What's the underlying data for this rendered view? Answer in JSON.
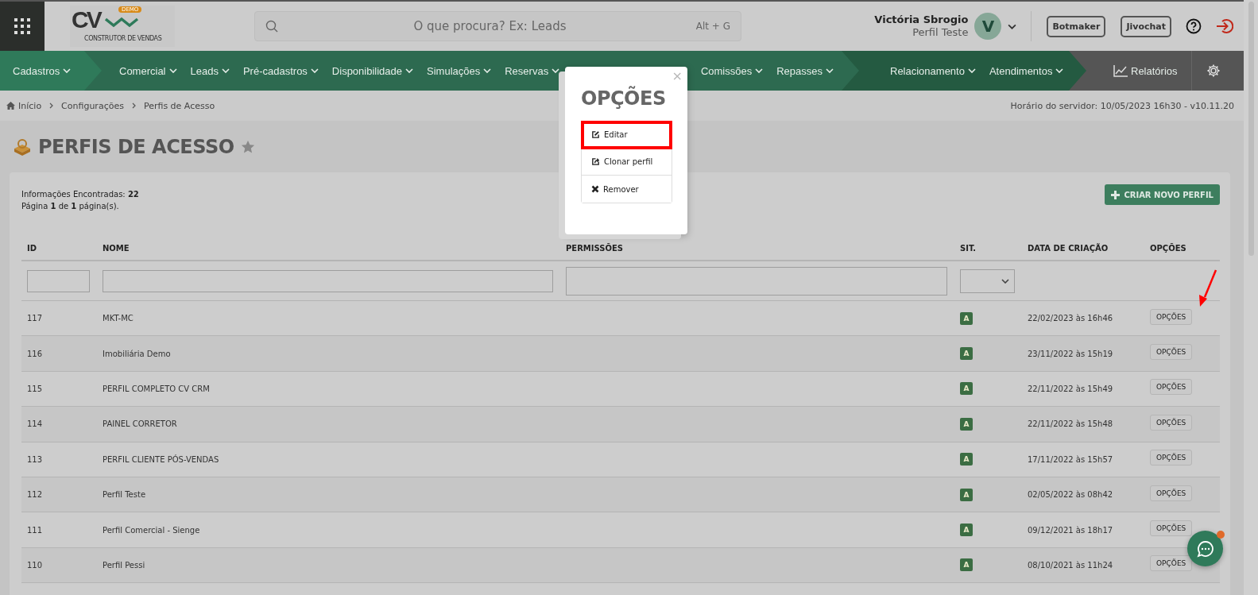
{
  "header": {
    "logo_text": "CV",
    "logo_badge": "DEMO",
    "logo_tagline": "CONSTRUTOR DE VENDAS",
    "search": {
      "placeholder": "O que procura? Ex: Leads",
      "shortcut": "Alt + G"
    },
    "user": {
      "name": "Victória Sbrogio",
      "role": "Perfil Teste",
      "initial": "V"
    },
    "buttons": [
      "Botmaker",
      "Jivochat"
    ]
  },
  "nav": [
    {
      "items": [
        "Cadastros"
      ]
    },
    {
      "items": [
        "Comercial",
        "Leads",
        "Pré-cadastros",
        "Disponibilidade",
        "Simulações",
        "Reservas",
        "Comissões",
        "Repasses"
      ]
    },
    {
      "items": [
        "Relacionamento",
        "Atendimentos"
      ]
    },
    {
      "items": [
        "Relatórios"
      ],
      "kind": "tools"
    }
  ],
  "breadcrumb": [
    "Início",
    "Configurações",
    "Perfis de Acesso"
  ],
  "server_time": "Horário do servidor: 10/05/2023 16h30 - v10.11.20",
  "page_title": "PERFIS DE ACESSO",
  "summary": [
    "Informações Encontradas: **22**",
    "Página **1** de **1** página(s)."
  ],
  "create_button": "CRIAR NOVO PERFIL",
  "table": {
    "columns": [
      {
        "label": "ID",
        "kind": "text"
      },
      {
        "label": "NOME",
        "kind": "text"
      },
      {
        "label": "PERMISSÕES",
        "kind": "textarea"
      },
      {
        "label": "SIT.",
        "kind": "select"
      },
      {
        "label": "DATA DE CRIAÇÃO",
        "kind": "none"
      },
      {
        "label": "OPÇÕES",
        "kind": "none"
      }
    ],
    "rows": [
      {
        "id": "117",
        "name": "MKT-MC",
        "status": "A",
        "created": "22/02/2023 às 16h46",
        "action": "OPÇÕES"
      },
      {
        "id": "116",
        "name": "Imobiliária Demo",
        "status": "A",
        "created": "23/11/2022 às 15h19",
        "action": "OPÇÕES"
      },
      {
        "id": "115",
        "name": "PERFIL COMPLETO CV CRM",
        "status": "A",
        "created": "22/11/2022 às 15h49",
        "action": "OPÇÕES"
      },
      {
        "id": "114",
        "name": "PAINEL CORRETOR",
        "status": "A",
        "created": "22/11/2022 às 15h48",
        "action": "OPÇÕES"
      },
      {
        "id": "113",
        "name": "PERFIL CLIENTE PÓS-VENDAS",
        "status": "A",
        "created": "17/11/2022 às 15h57",
        "action": "OPÇÕES"
      },
      {
        "id": "112",
        "name": "Perfil Teste",
        "status": "A",
        "created": "02/05/2022 às 08h42",
        "action": "OPÇÕES"
      },
      {
        "id": "111",
        "name": "Perfil Comercial - Sienge",
        "status": "A",
        "created": "09/12/2021 às 18h17",
        "action": "OPÇÕES"
      },
      {
        "id": "110",
        "name": "Perfil Pessi",
        "status": "A",
        "created": "08/10/2021 às 11h24",
        "action": "OPÇÕES"
      }
    ]
  },
  "modal": {
    "title": "OPÇÕES",
    "close": "×",
    "options": [
      {
        "label": "Editar",
        "kind": "edit",
        "highlighted": true
      },
      {
        "label": "Clonar perfil",
        "kind": "clone",
        "highlighted": false
      },
      {
        "label": "Remover",
        "kind": "remove",
        "highlighted": false
      }
    ]
  }
}
